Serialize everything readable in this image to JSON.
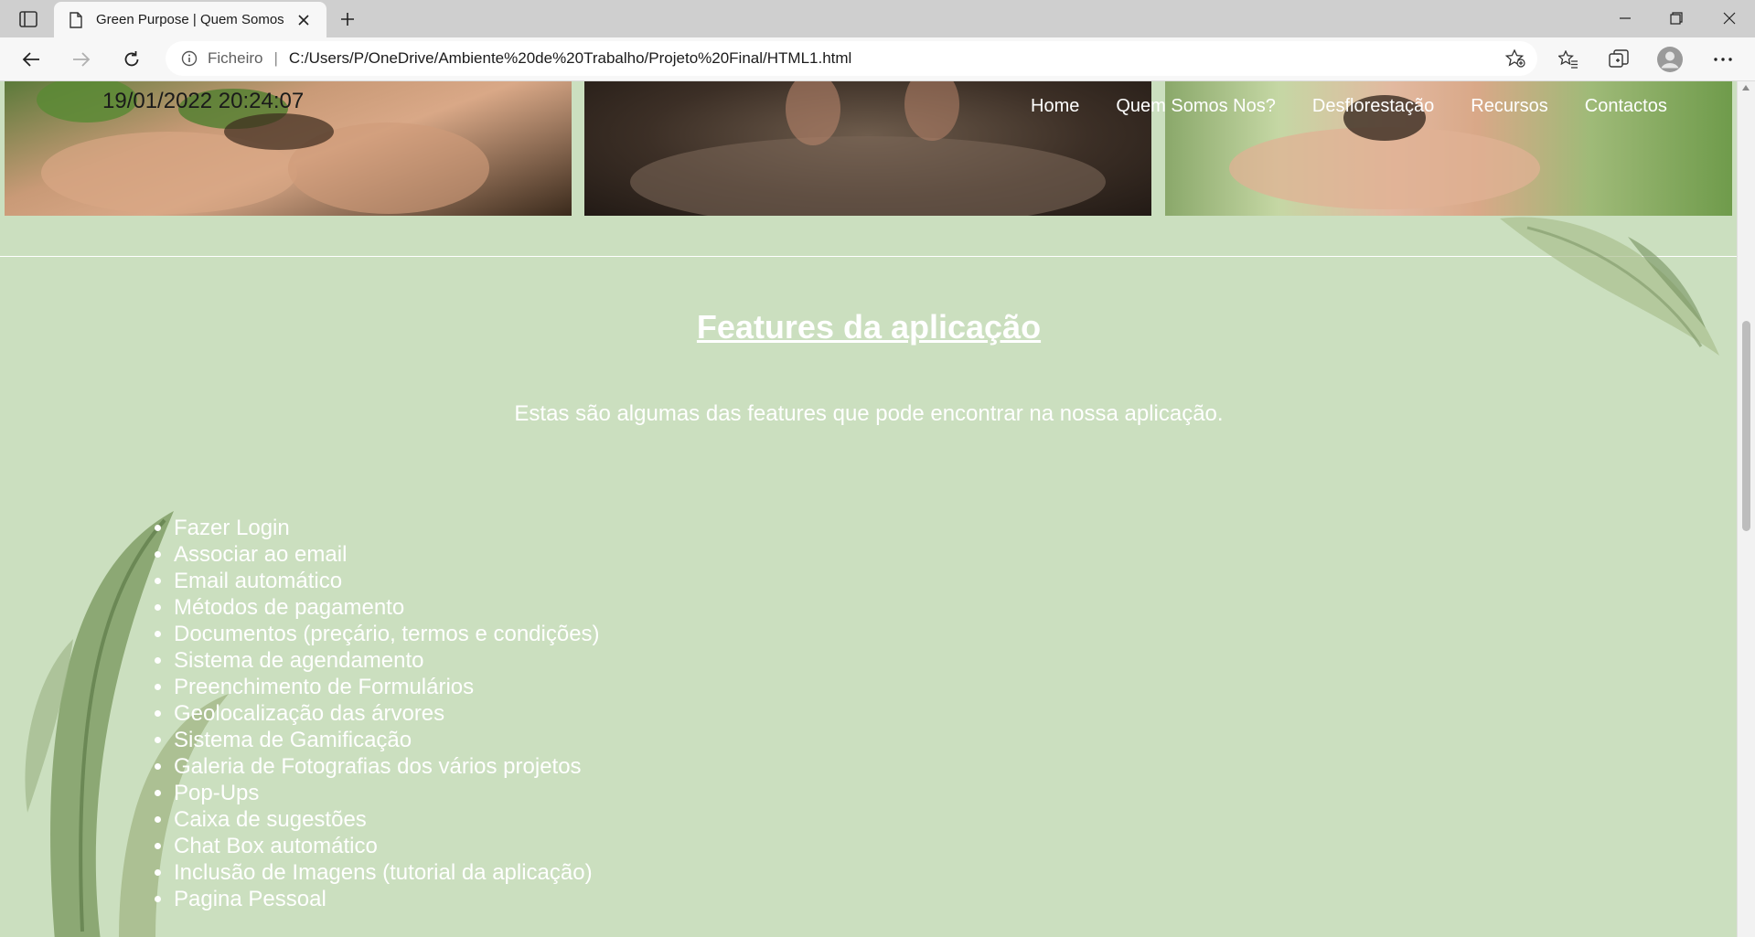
{
  "browser": {
    "tab_title": "Green Purpose | Quem Somos Nos",
    "address_scheme": "Ficheiro",
    "address_separator": "|",
    "url": "C:/Users/P/OneDrive/Ambiente%20de%20Trabalho/Projeto%20Final/HTML1.html"
  },
  "header": {
    "datetime": "19/01/2022 20:24:07",
    "nav": [
      "Home",
      "Quem Somos Nos?",
      "Desflorestação",
      "Recursos",
      "Contactos"
    ]
  },
  "main": {
    "heading": "Features da aplicação",
    "subtitle": "Estas são algumas das features que pode encontrar na nossa aplicação.",
    "features": [
      "Fazer Login",
      "Associar ao email",
      "Email automático",
      "Métodos de pagamento",
      "Documentos (preçário, termos e condições)",
      "Sistema de agendamento",
      "Preenchimento de Formulários",
      "Geolocalização das árvores",
      "Sistema de Gamificação",
      "Galeria de Fotografias dos vários projetos",
      "Pop-Ups",
      "Caixa de sugestões",
      "Chat Box automático",
      "Inclusão de Imagens (tutorial da aplicação)",
      "Pagina Pessoal"
    ]
  },
  "colors": {
    "page_background": "#cbdfbf",
    "text": "#ffffff"
  }
}
